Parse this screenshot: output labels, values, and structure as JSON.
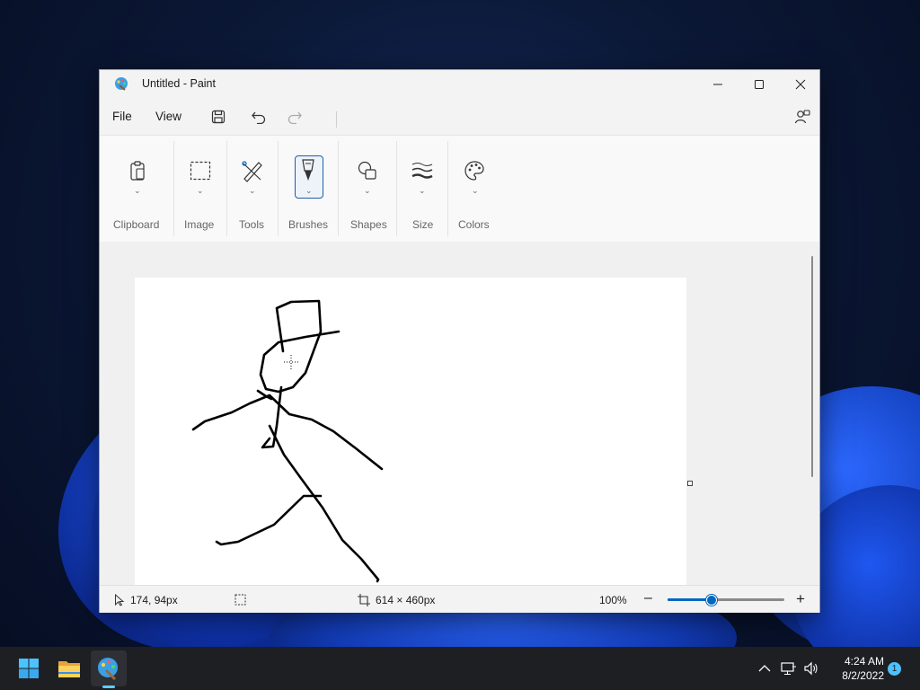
{
  "window": {
    "title": "Untitled - Paint",
    "controls": [
      "minimize",
      "maximize",
      "close"
    ]
  },
  "menu": {
    "file": "File",
    "view": "View",
    "toolbar_icons": [
      "save-icon",
      "undo-icon",
      "redo-icon",
      "account-icon"
    ]
  },
  "ribbon": {
    "groups": [
      {
        "label": "Clipboard",
        "icon": "clipboard-icon"
      },
      {
        "label": "Image",
        "icon": "selection-icon"
      },
      {
        "label": "Tools",
        "icon": "tools-icon"
      },
      {
        "label": "Brushes",
        "icon": "brush-icon",
        "selected": true
      },
      {
        "label": "Shapes",
        "icon": "shapes-icon"
      },
      {
        "label": "Size",
        "icon": "size-icon"
      },
      {
        "label": "Colors",
        "icon": "palette-icon"
      }
    ]
  },
  "status": {
    "cursor_pos": "174, 94px",
    "canvas_size": "614 × 460px",
    "zoom": "100%",
    "zoom_fraction": 0.38
  },
  "taskbar": {
    "apps": [
      "windows-start-icon",
      "file-explorer-icon",
      "paint-icon"
    ],
    "active_app": "paint-icon",
    "time": "4:24 AM",
    "date": "8/2/2022",
    "notifications": "1",
    "accent": "#60cdff"
  }
}
